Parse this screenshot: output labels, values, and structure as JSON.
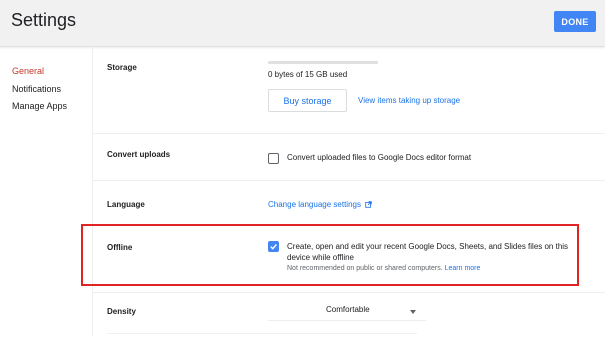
{
  "header": {
    "title": "Settings",
    "done_label": "DONE"
  },
  "sidebar": {
    "items": [
      {
        "label": "General",
        "active": true
      },
      {
        "label": "Notifications",
        "active": false
      },
      {
        "label": "Manage Apps",
        "active": false
      }
    ]
  },
  "storage": {
    "label": "Storage",
    "usage_text": "0 bytes of 15 GB used",
    "usage_fraction": 0,
    "buy_label": "Buy storage",
    "view_link": "View items taking up storage"
  },
  "convert": {
    "label": "Convert uploads",
    "checkbox_text": "Convert uploaded files to Google Docs editor format",
    "checked": false
  },
  "language": {
    "label": "Language",
    "link": "Change language settings",
    "link_icon": "open-in-new-icon"
  },
  "offline": {
    "label": "Offline",
    "checkbox_line1": "Create, open and edit your recent Google Docs, Sheets, and Slides files on this",
    "checkbox_line2": "device while offline",
    "note": "Not recommended on public or shared computers.",
    "learn_more": "Learn more",
    "checked": true
  },
  "density": {
    "label": "Density",
    "value": "Comfortable"
  },
  "colors": {
    "accent": "#4285f4",
    "link": "#1a73e8",
    "active_nav": "#c53929",
    "highlight": "#e02424"
  }
}
